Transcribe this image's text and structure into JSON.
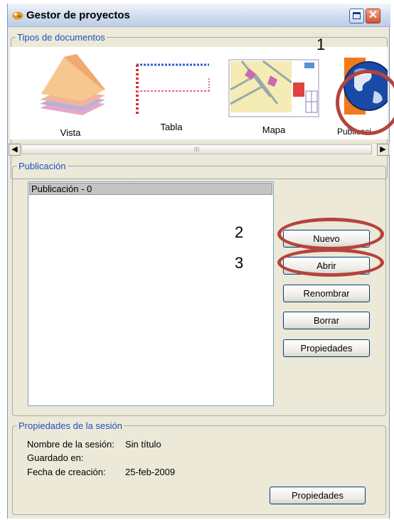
{
  "window": {
    "title": "Gestor de proyectos",
    "maximize_glyph": "",
    "close_glyph": "✕"
  },
  "doc_types": {
    "legend": "Tipos de documentos",
    "items": [
      {
        "label": "Vista"
      },
      {
        "label": "Tabla"
      },
      {
        "label": "Mapa"
      },
      {
        "label": "Publicaci"
      }
    ],
    "scroll_thumb_grip": "III"
  },
  "publication": {
    "legend": "Publicación",
    "list": [
      "Publicación - 0"
    ],
    "buttons": {
      "new": "Nuevo",
      "open": "Abrir",
      "rename": "Renombrar",
      "delete": "Borrar",
      "properties": "Propiedades"
    }
  },
  "session": {
    "legend": "Propiedades de la sesión",
    "name_label": "Nombre de la sesión:",
    "name_value": "Sin título",
    "saved_label": "Guardado en:",
    "saved_value": "",
    "date_label": "Fecha de creación:",
    "date_value": "25-feb-2009",
    "properties_button": "Propiedades"
  },
  "annotations": {
    "n1": "1",
    "n2": "2",
    "n3": "3"
  },
  "colors": {
    "annotation_ring": "#b5433f",
    "legend_text": "#1f4fbf",
    "selection": "#c4c3c6"
  }
}
